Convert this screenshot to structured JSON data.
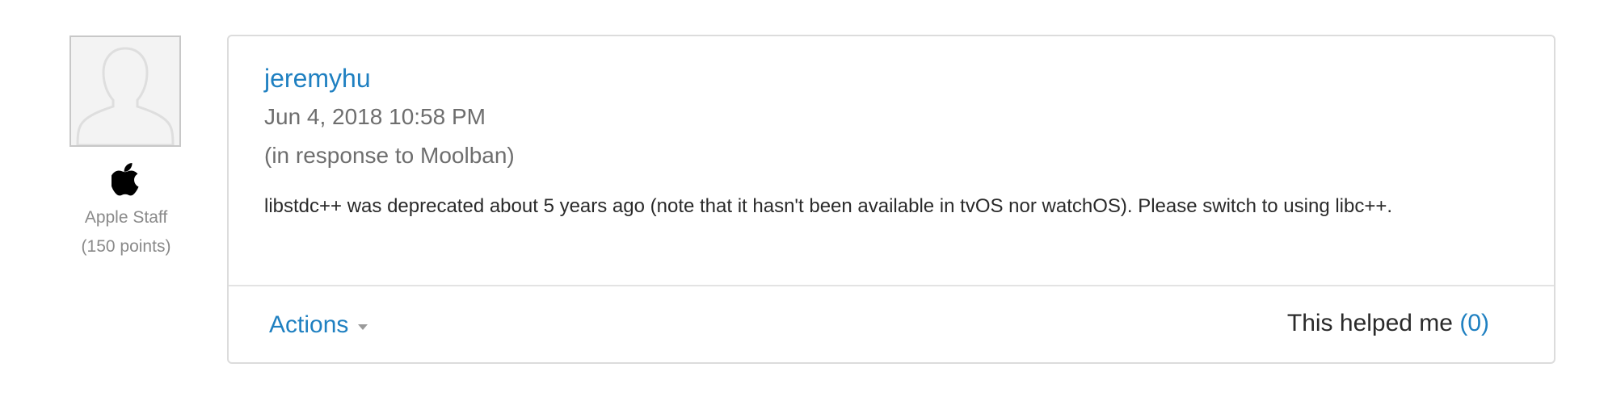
{
  "author": {
    "avatar_icon": "default-user-silhouette-icon",
    "badge_icon": "apple-logo-icon",
    "role": "Apple Staff",
    "points": "(150 points)"
  },
  "post": {
    "username": "jeremyhu",
    "timestamp": "Jun 4, 2018 10:58 PM",
    "in_response_prefix": "(in response to ",
    "in_response_target": "Moolban",
    "in_response_suffix": ")",
    "message": "libstdc++ was deprecated about 5 years ago (note that it hasn't been available in tvOS nor watchOS).  Please switch to using libc++."
  },
  "footer": {
    "actions_label": "Actions",
    "actions_icon": "chevron-down-icon",
    "helped_label": "This helped me ",
    "helped_count": "(0)"
  },
  "colors": {
    "link": "#1f80c1",
    "muted_text": "#6e6e6e",
    "body_text": "#2a2a2a",
    "border": "#dcdcdc"
  }
}
